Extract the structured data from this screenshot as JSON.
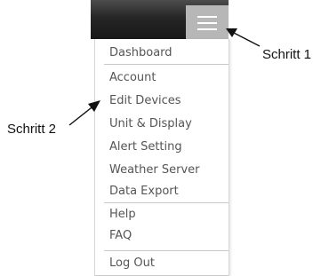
{
  "menu": {
    "button_icon": "hamburger-menu-icon",
    "items": [
      {
        "label": "Dashboard"
      },
      {
        "label": "Account"
      },
      {
        "label": "Edit Devices"
      },
      {
        "label": "Unit & Display"
      },
      {
        "label": "Alert Setting"
      },
      {
        "label": "Weather Server"
      },
      {
        "label": "Data Export"
      },
      {
        "label": "Help"
      },
      {
        "label": "FAQ"
      },
      {
        "label": "Log Out"
      }
    ]
  },
  "annotations": {
    "step1": "Schritt 1",
    "step2": "Schritt 2"
  },
  "colors": {
    "header": "#262626",
    "menu_button": "#b7b7b7",
    "menu_text": "#555555",
    "divider": "#c9c9c9"
  }
}
